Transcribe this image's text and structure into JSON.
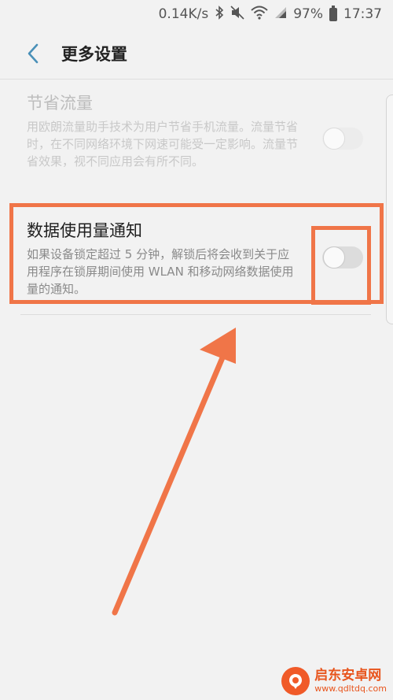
{
  "status_bar": {
    "speed": "0.14K/s",
    "battery": "97%",
    "time": "17:37",
    "icons": [
      "bluetooth-icon",
      "mute-icon",
      "wifi-icon",
      "signal-icon",
      "battery-icon"
    ]
  },
  "header": {
    "title": "更多设置",
    "back_icon": "chevron-left-icon"
  },
  "settings": [
    {
      "title": "节省流量",
      "description": "用欧朗流量助手技术为用户节省手机流量。流量节省时，在不同网络环境下网速可能受一定影响。流量节省效果，视不同应用会有所不同。",
      "enabled": false,
      "toggle_on": false
    },
    {
      "title": "数据使用量通知",
      "description": "如果设备锁定超过 5 分钟，解锁后将会收到关于应用程序在锁屏期间使用 WLAN 和移动网络数据使用量的通知。",
      "enabled": true,
      "toggle_on": false
    }
  ],
  "colors": {
    "annotation": "#f07548",
    "back_icon": "#4a90b8",
    "background": "#f2f2f2"
  },
  "watermark": {
    "name": "启东安卓网",
    "url": "www.qdltdq.com"
  }
}
